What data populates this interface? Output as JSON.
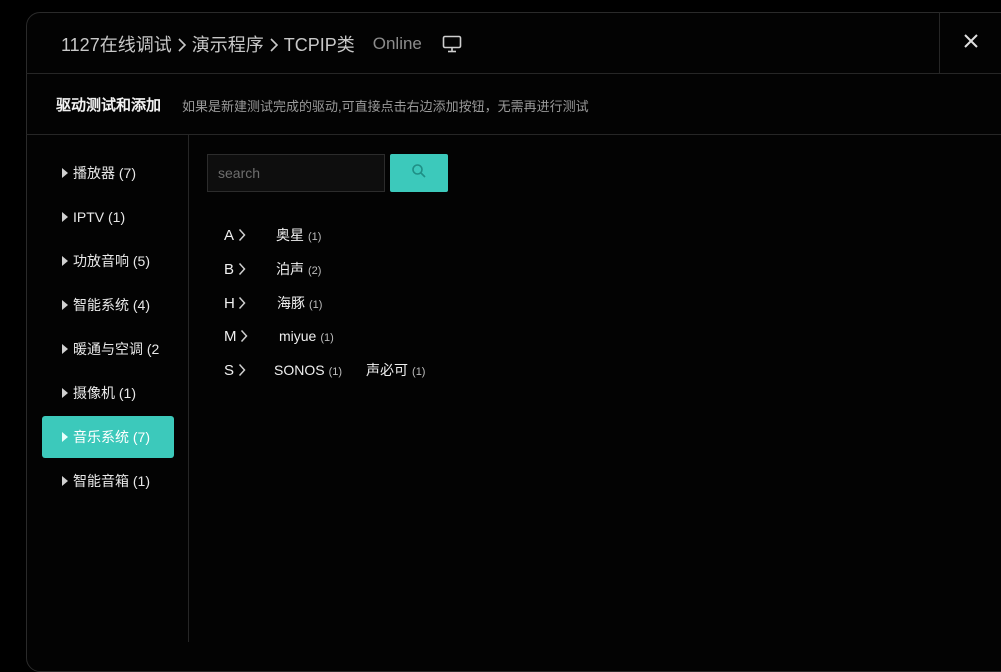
{
  "breadcrumb": {
    "items": [
      "1127在线调试",
      "演示程序",
      "TCPIP类"
    ],
    "status": "Online"
  },
  "section": {
    "title": "驱动测试和添加",
    "hint": "如果是新建测试完成的驱动,可直接点击右边添加按钮，无需再进行测试"
  },
  "sidebar": {
    "items": [
      {
        "label": "播放器 (7)"
      },
      {
        "label": "IPTV (1)"
      },
      {
        "label": "功放音响 (5)"
      },
      {
        "label": "智能系统 (4)"
      },
      {
        "label": "暖通与空调 (2"
      },
      {
        "label": "摄像机 (1)"
      },
      {
        "label": "音乐系统 (7)",
        "active": true
      },
      {
        "label": "智能音箱 (1)"
      }
    ]
  },
  "search": {
    "placeholder": "search"
  },
  "brand_groups": [
    {
      "letter": "A",
      "brands": [
        {
          "name": "奥星",
          "count": "(1)"
        }
      ]
    },
    {
      "letter": "B",
      "brands": [
        {
          "name": "泊声",
          "count": "(2)"
        }
      ]
    },
    {
      "letter": "H",
      "brands": [
        {
          "name": "海豚",
          "count": "(1)"
        }
      ]
    },
    {
      "letter": "M",
      "brands": [
        {
          "name": "miyue",
          "count": "(1)"
        }
      ]
    },
    {
      "letter": "S",
      "brands": [
        {
          "name": "SONOS",
          "count": "(1)"
        },
        {
          "name": "声必可",
          "count": "(1)"
        }
      ]
    }
  ],
  "colors": {
    "accent": "#3cc9bb",
    "background": "#000000"
  },
  "icons": {
    "monitor": "monitor-icon",
    "close": "close-icon",
    "search": "search-icon",
    "chevron": "chevron-right-icon"
  }
}
